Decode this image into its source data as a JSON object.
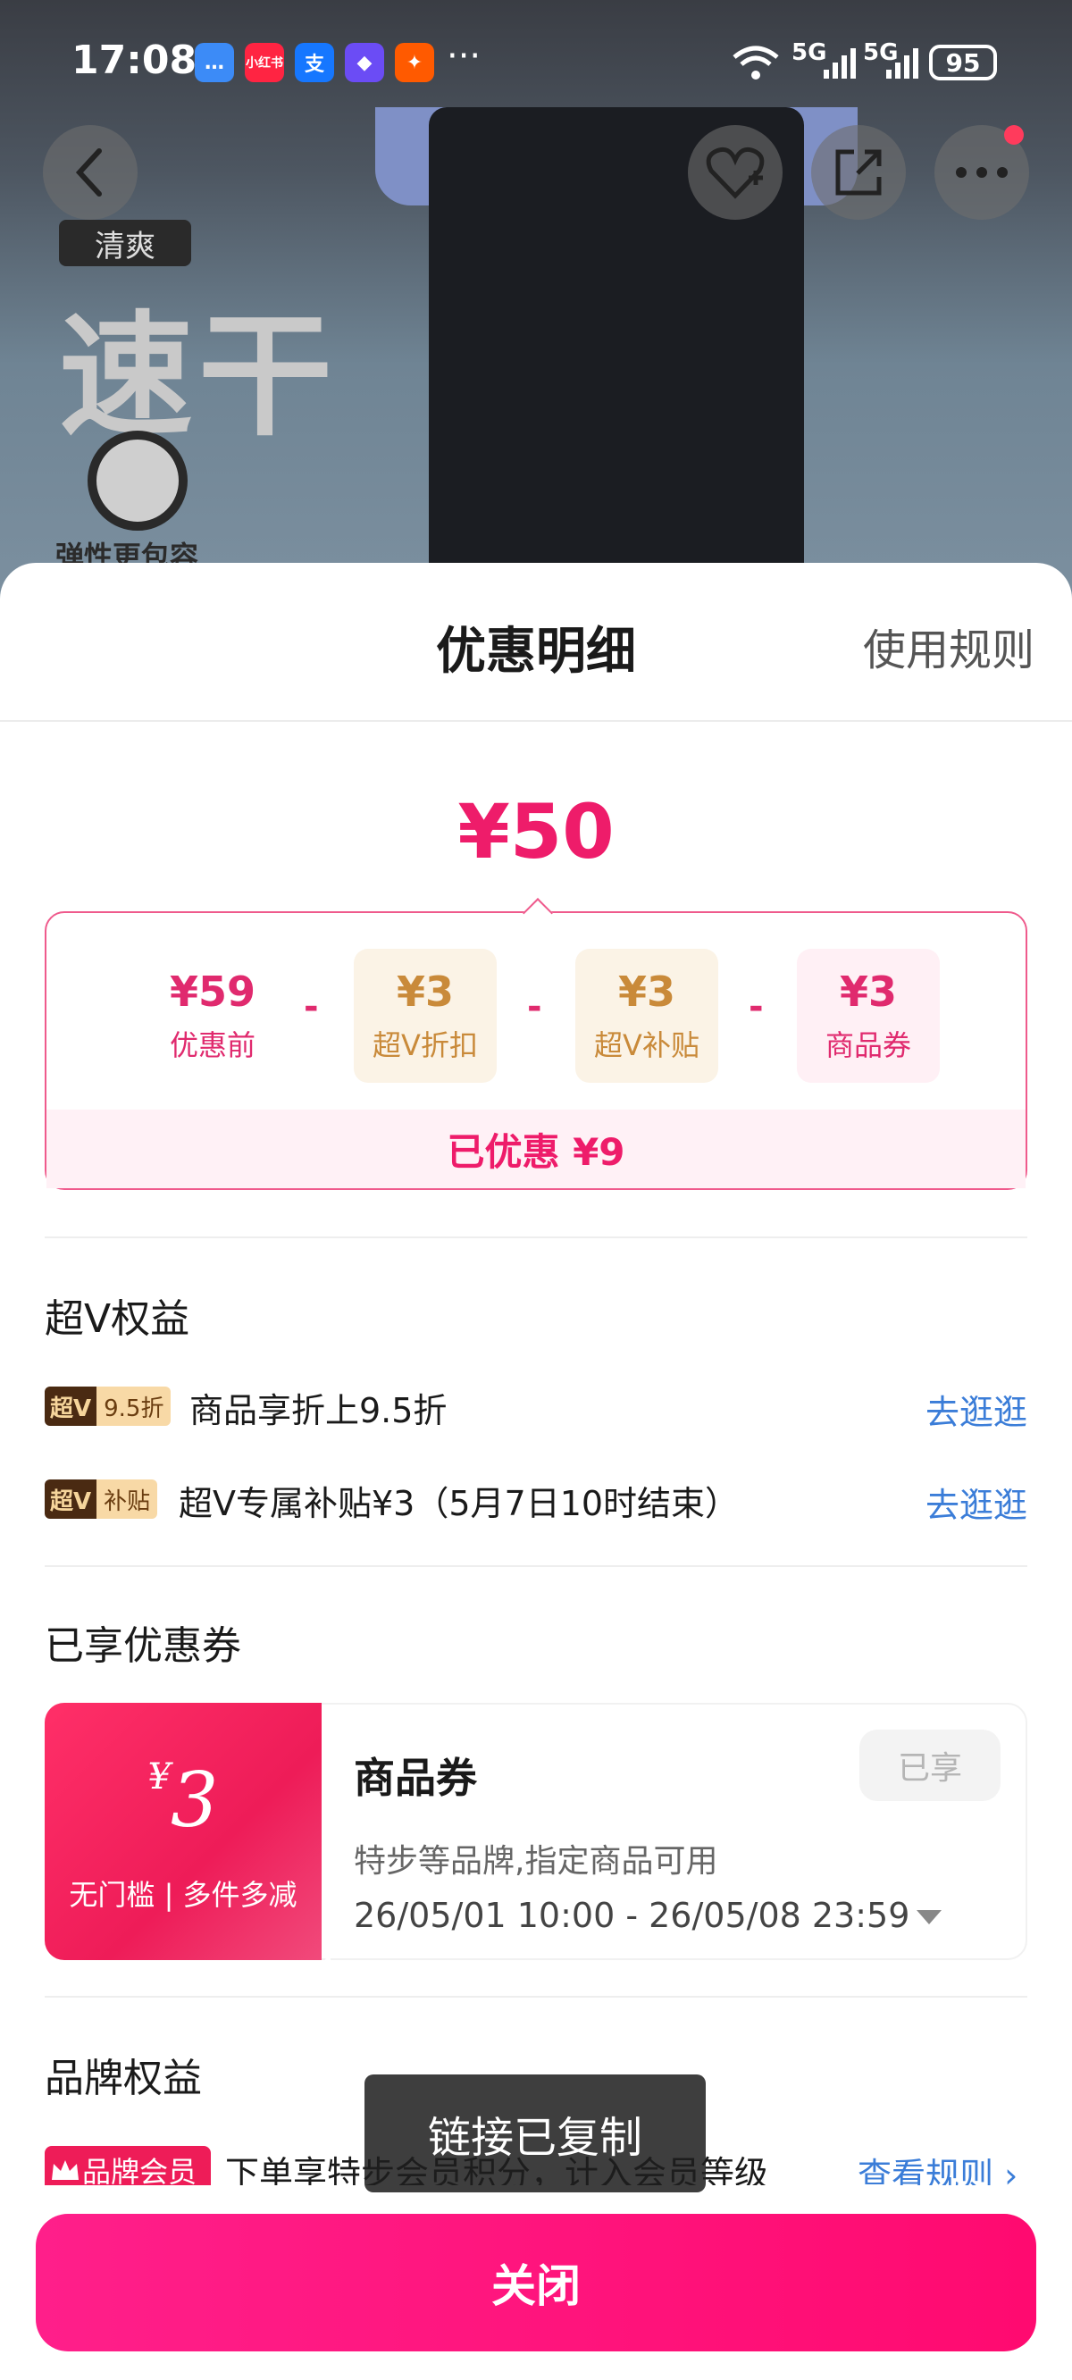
{
  "status_bar": {
    "time": "17:08",
    "apps": [
      {
        "icon": "message-icon",
        "color": "#3c8bf7",
        "glyph": "…"
      },
      {
        "icon": "xiaohongshu-icon",
        "color": "#ff2442",
        "glyph": "小红书"
      },
      {
        "icon": "alipay-icon",
        "color": "#1677ff",
        "glyph": "支"
      },
      {
        "icon": "diamond-app-icon",
        "color": "#6b4cf5",
        "glyph": "◆"
      },
      {
        "icon": "taobao-app-icon",
        "color": "#ff5a00",
        "glyph": "✦"
      }
    ],
    "more": "···",
    "signal_1": "5G",
    "signal_2": "5G",
    "battery": "95"
  },
  "banner": {
    "tag": "清爽",
    "headline": "速干",
    "caption": "弹性更包容"
  },
  "sheet": {
    "title": "优惠明细",
    "rules_link": "使用规则",
    "final_price": "¥50",
    "breakdown": [
      {
        "value": "¥59",
        "label": "优惠前"
      },
      {
        "value": "¥3",
        "label": "超V折扣"
      },
      {
        "value": "¥3",
        "label": "超V补贴"
      },
      {
        "value": "¥3",
        "label": "商品券"
      }
    ],
    "operator": "-",
    "saved_total": "已优惠 ¥9"
  },
  "super_v": {
    "title": "超V权益",
    "items": [
      {
        "badge_a": "超V",
        "badge_b": "9.5折",
        "text": "商品享折上9.5折",
        "action": "去逛逛"
      },
      {
        "badge_a": "超V",
        "badge_b": "补贴",
        "text": "超V专属补贴¥3（5月7日10时结束）",
        "action": "去逛逛"
      }
    ]
  },
  "coupons": {
    "title": "已享优惠券",
    "item": {
      "currency": "¥",
      "amount": "3",
      "condition": "无门槛 | 多件多减",
      "name": "商品券",
      "status": "已享",
      "description": "特步等品牌,指定商品可用",
      "validity": "26/05/01 10:00 - 26/05/08 23:59"
    }
  },
  "brand": {
    "title": "品牌权益",
    "badge": "品牌会员",
    "text": "下单享特步会员积分，计入会员等级",
    "action": "查看规则 ›"
  },
  "toast": "链接已复制",
  "footer": {
    "close_label": "关闭"
  },
  "colors": {
    "accent": "#ee1c6a",
    "link": "#3b7dd8",
    "gold": "#c98a3a"
  }
}
